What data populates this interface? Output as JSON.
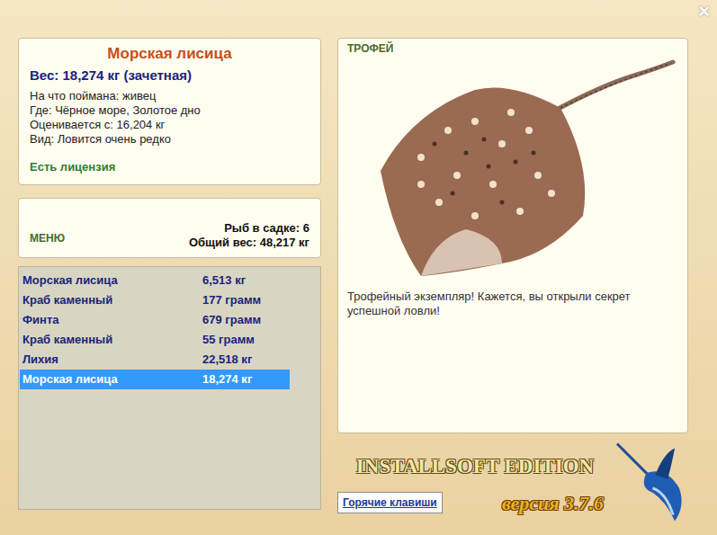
{
  "window": {
    "close": "×"
  },
  "fish_info": {
    "title": "Морская лисица",
    "weight": "Вес: 18,274 кг (зачетная)",
    "details": [
      "На что поймана: живец",
      "Где: Чёрное море, Золотое дно",
      "Оценивается с: 16,204 кг",
      "Вид: Ловится очень редко"
    ],
    "license": "Есть лицензия"
  },
  "menu": {
    "label": "МЕНЮ",
    "count": "Рыб в садке: 6",
    "total": "Общий вес: 48,217 кг"
  },
  "catch_list": [
    {
      "name": "Морская лисица",
      "weight": "6,513 кг",
      "selected": false
    },
    {
      "name": "Краб каменный",
      "weight": "177 грамм",
      "selected": false
    },
    {
      "name": "Финта",
      "weight": "679 грамм",
      "selected": false
    },
    {
      "name": "Краб каменный",
      "weight": "55 грамм",
      "selected": false
    },
    {
      "name": "Лихия",
      "weight": "22,518 кг",
      "selected": false
    },
    {
      "name": "Морская лисица",
      "weight": "18,274 кг",
      "selected": true
    }
  ],
  "trophy": {
    "label": "ТРОФЕЙ",
    "message": "Трофейный экземпляр! Кажется, вы открыли секрет успешной ловли!"
  },
  "logo": {
    "title": "INSTALLSOFT EDITION",
    "version": "версия 3.7.6"
  },
  "buttons": [
    "Горячие клавиши"
  ]
}
